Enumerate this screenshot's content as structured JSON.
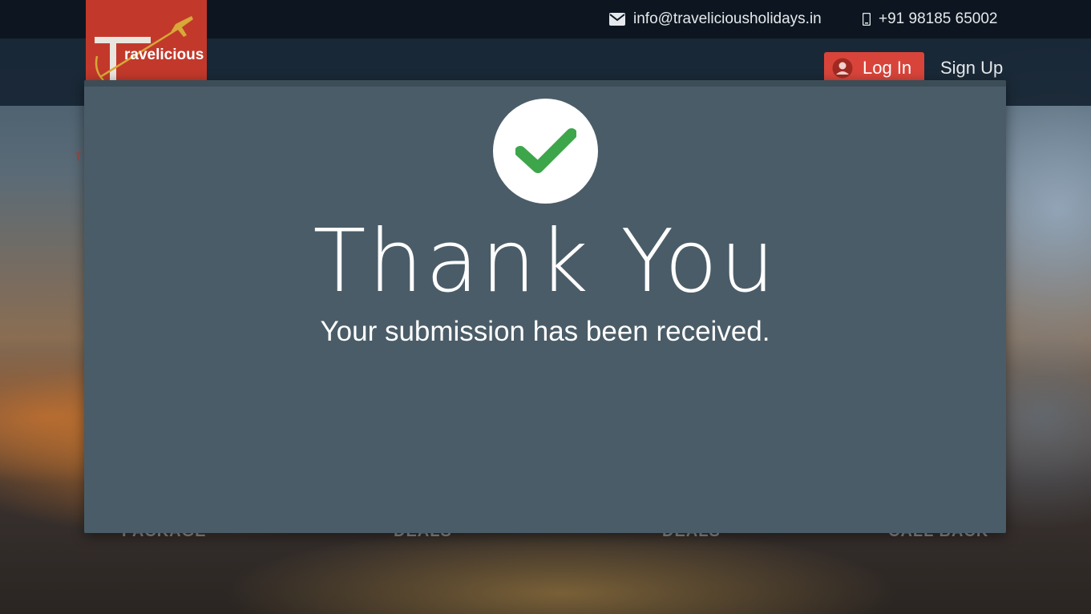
{
  "header": {
    "email": "info@traveliciousholidays.in",
    "phone": "+91 98185 65002",
    "logo_text": "ravelicious",
    "logo_letter": "T",
    "login_label": "Log In",
    "signup_label": "Sign Up"
  },
  "background": {
    "crumb": "T",
    "under_labels": [
      "PACKAGE",
      "DEALS",
      "DEALS",
      "CALL BACK"
    ]
  },
  "modal": {
    "title": "Thank You",
    "message": "Your submission has been received.",
    "icon": "check-icon"
  },
  "colors": {
    "brand_red": "#c2392b",
    "login_red": "#d9443a",
    "modal_bg": "#4a5c67",
    "check_green": "#3da64a"
  }
}
